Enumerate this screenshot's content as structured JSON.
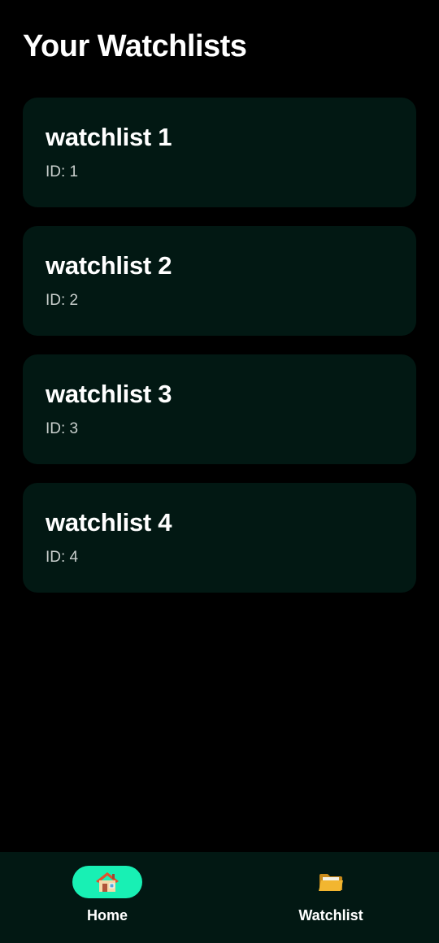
{
  "header": {
    "title": "Your Watchlists"
  },
  "watchlists": [
    {
      "name": "watchlist 1",
      "id_label": "ID: 1"
    },
    {
      "name": "watchlist 2",
      "id_label": "ID: 2"
    },
    {
      "name": "watchlist 3",
      "id_label": "ID: 3"
    },
    {
      "name": "watchlist 4",
      "id_label": "ID: 4"
    }
  ],
  "bottom_nav": {
    "items": [
      {
        "label": "Home",
        "icon": "house-icon",
        "active": true
      },
      {
        "label": "Watchlist",
        "icon": "folder-icon",
        "active": false
      }
    ]
  },
  "colors": {
    "background": "#000000",
    "card": "#021813",
    "accent": "#18f0b4",
    "text_secondary": "#c9cfcd"
  }
}
